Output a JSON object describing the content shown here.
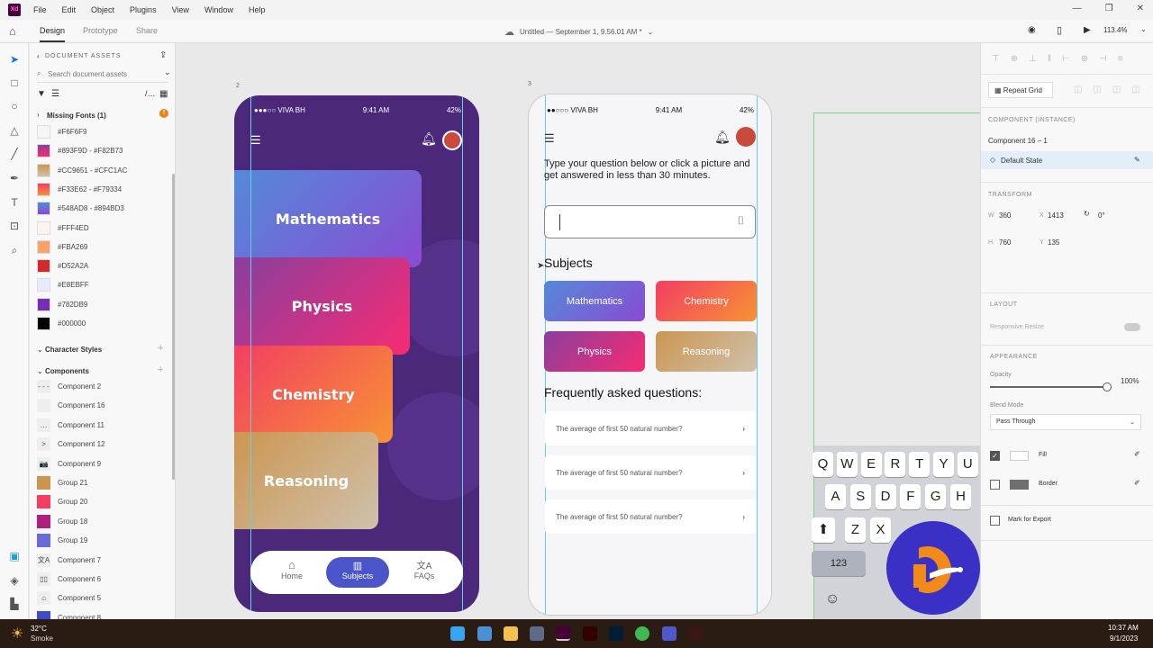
{
  "app": {
    "logo": "Xd",
    "menu": [
      "File",
      "Edit",
      "Object",
      "Plugins",
      "View",
      "Window",
      "Help"
    ],
    "doc_title": "Untitled — September 1, 9.56.01 AM *",
    "zoom": "113.4%"
  },
  "tabs": [
    "Design",
    "Prototype",
    "Share"
  ],
  "assets": {
    "header": "DOCUMENT ASSETS",
    "search_placeholder": "Search document assets",
    "missing_fonts": "Missing Fonts (1)",
    "colors": [
      {
        "label": "#F6F6F9",
        "c1": "#F6F6F9",
        "c2": "#F6F6F9"
      },
      {
        "label": "#893F9D - #F82B73",
        "c1": "#893F9D",
        "c2": "#F82B73"
      },
      {
        "label": "#CC9651 - #CFC1AC",
        "c1": "#CC9651",
        "c2": "#CFC1AC"
      },
      {
        "label": "#F33E62 - #F79334",
        "c1": "#F33E62",
        "c2": "#F79334"
      },
      {
        "label": "#548AD8 - #894BD3",
        "c1": "#548AD8",
        "c2": "#894BD3"
      },
      {
        "label": "#FFF4ED",
        "c1": "#FFF4ED",
        "c2": "#FFF4ED"
      },
      {
        "label": "#FBA269",
        "c1": "#FBA269",
        "c2": "#FBA269"
      },
      {
        "label": "#D52A2A",
        "c1": "#D52A2A",
        "c2": "#D52A2A"
      },
      {
        "label": "#E8EBFF",
        "c1": "#E8EBFF",
        "c2": "#E8EBFF"
      },
      {
        "label": "#782DB9",
        "c1": "#782DB9",
        "c2": "#782DB9"
      },
      {
        "label": "#000000",
        "c1": "#000000",
        "c2": "#000000"
      }
    ],
    "character_styles": "Character Styles",
    "components_header": "Components",
    "components": [
      {
        "label": "Component 2",
        "thumb": "- - -"
      },
      {
        "label": "Component 16",
        "thumb": ""
      },
      {
        "label": "Component 11",
        "thumb": "…"
      },
      {
        "label": "Component 12",
        "thumb": ">"
      },
      {
        "label": "Component 9",
        "thumb": "📷"
      },
      {
        "label": "Group 21",
        "thumb": "#CC9651"
      },
      {
        "label": "Group 20",
        "thumb": "#F33E62"
      },
      {
        "label": "Group 18",
        "thumb": "#B0207F"
      },
      {
        "label": "Group 19",
        "thumb": "#6A6AD8"
      },
      {
        "label": "Component 7",
        "thumb": "文A"
      },
      {
        "label": "Component 6",
        "thumb": "▯▯"
      },
      {
        "label": "Component 5",
        "thumb": "⌂"
      },
      {
        "label": "Component 8",
        "thumb": "#3F4BC8"
      }
    ]
  },
  "artboard1": {
    "number": "2",
    "status": {
      "carrier": "●●●○○ VIVA BH",
      "time": "9:41 AM",
      "battery": "42%"
    },
    "cards": [
      "Mathematics",
      "Physics",
      "Chemistry",
      "Reasoning"
    ],
    "nav": [
      "Home",
      "Subjects",
      "FAQs"
    ]
  },
  "artboard2": {
    "number": "3",
    "status": {
      "carrier": "●●○○○ VIVA BH",
      "time": "9:41 AM",
      "battery": "42%"
    },
    "prompt": "Type your question below or click a picture and get answered in less than 30 minutes.",
    "subjects_title": "Subjects",
    "subjects": [
      "Mathematics",
      "Chemistry",
      "Physics",
      "Reasoning"
    ],
    "faq_title": "Frequently asked questions:",
    "faqs": [
      "The average of first 50 natural number?",
      "The average of first 50 natural number?",
      "The average of first 50 natural number?"
    ]
  },
  "keyboard": {
    "row1": [
      "Q",
      "W",
      "E",
      "R",
      "T",
      "Y",
      "U"
    ],
    "row2": [
      "A",
      "S",
      "D",
      "F",
      "G",
      "H"
    ],
    "row3": [
      "Z",
      "X"
    ],
    "numbers": "123"
  },
  "right_panel": {
    "repeat_grid": "Repeat Grid",
    "component_label": "COMPONENT (INSTANCE)",
    "component_name": "Component 16 – 1",
    "state": "Default State",
    "transform_label": "TRANSFORM",
    "w": "360",
    "x": "1413",
    "rotation": "0°",
    "h": "760",
    "y": "135",
    "layout_label": "LAYOUT",
    "responsive": "Responsive Resize",
    "appearance_label": "APPEARANCE",
    "opacity_label": "Opacity",
    "opacity": "100%",
    "opacity_value": 1.0,
    "blend_label": "Blend Mode",
    "blend": "Pass Through",
    "fill": "Fill",
    "fill_checked": true,
    "border": "Border",
    "border_checked": false,
    "export": "Mark for Export"
  },
  "taskbar": {
    "temp": "32°C",
    "weather": "Smoke",
    "time": "10:37 AM",
    "date": "9/1/2023"
  }
}
